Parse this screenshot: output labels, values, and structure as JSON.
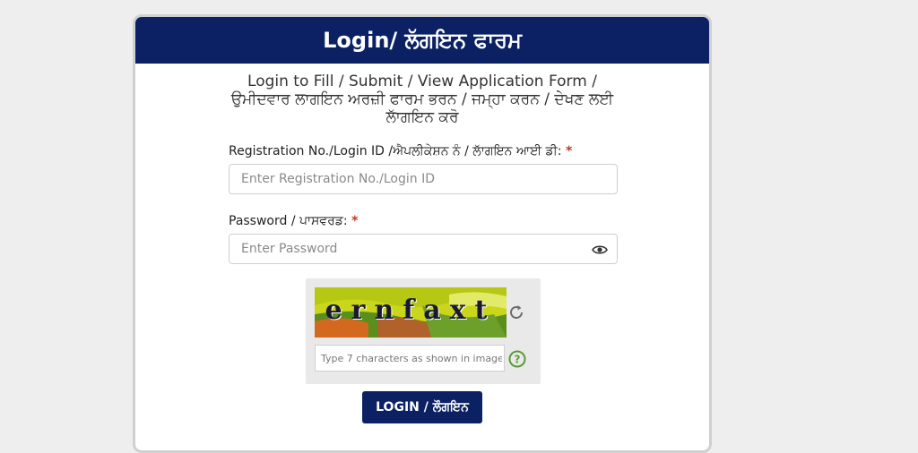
{
  "header": {
    "title": "Login/ ਲੱਗਇਨ ਫਾਰਮ"
  },
  "intro": {
    "line1": "Login to Fill / Submit / View Application Form /",
    "line2": "ਉਮੀਦਵਾਰ ਲਾਗਇਨ ਅਰਜ਼ੀ ਫਾਰਮ ਭਰਨ / ਜਮ੍ਹਾ ਕਰਨ / ਦੇਖਣ ਲਈ",
    "line3": "ਲਾੱਗਇਨ ਕਰੋ"
  },
  "registration": {
    "label": "Registration No./Login ID /ਐਪਲੀਕੇਸ਼ਨ ਨੰ / ਲਾੱਗਇਨ ਆਈ ਡੀ:",
    "required_mark": "*",
    "placeholder": "Enter Registration No./Login ID",
    "value": ""
  },
  "password": {
    "label": "Password / ਪਾਸਵਰਡ:",
    "required_mark": "*",
    "placeholder": "Enter Password",
    "value": "",
    "toggle_icon": "eye-icon"
  },
  "captcha": {
    "image_text": "ernfaxt",
    "input_placeholder": "Type 7 characters as shown in image",
    "input_value": "",
    "refresh_icon": "refresh-icon",
    "help_icon": "help-icon"
  },
  "login_button": {
    "label": "LOGIN / ਲੌਗਇਨ"
  },
  "colors": {
    "header_bg": "#0b2163",
    "button_bg": "#0b2163",
    "required": "#c0392b",
    "help_green": "#5a9a3a"
  }
}
